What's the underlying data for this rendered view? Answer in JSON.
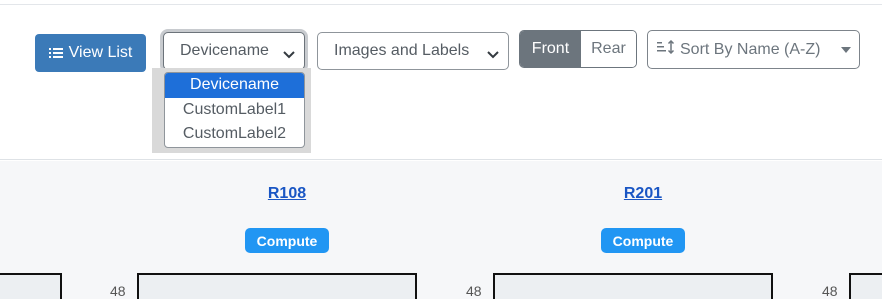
{
  "toolbar": {
    "view_list_label": "View List",
    "device_select_value": "Devicename",
    "device_options": [
      "Devicename",
      "CustomLabel1",
      "CustomLabel2"
    ],
    "display_select_value": "Images and Labels",
    "face_front_label": "Front",
    "face_rear_label": "Rear",
    "face_selected": "Front",
    "sort_label": "Sort By Name (A-Z)"
  },
  "racks": [
    {
      "name": "R108",
      "badge": "Compute",
      "top_unit": "48"
    },
    {
      "name": "R201",
      "badge": "Compute",
      "top_unit": "48"
    }
  ],
  "edge_units": [
    "48",
    "48"
  ],
  "colors": {
    "primary": "#3b7ab8",
    "badge": "#2196f3",
    "selected_option": "#1e6fd9",
    "segment_active": "#6c757d",
    "link": "#1a56c4"
  }
}
